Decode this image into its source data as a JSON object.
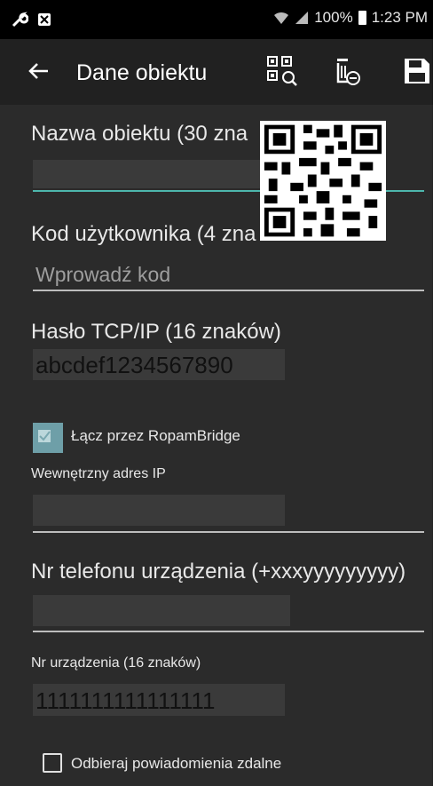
{
  "status_bar": {
    "battery": "100%",
    "time": "1:23 PM"
  },
  "app_bar": {
    "title": "Dane obiektu",
    "icons": [
      "back-arrow-icon",
      "qr-scan-icon",
      "delete-icon",
      "save-icon"
    ]
  },
  "form": {
    "object_name": {
      "label": "Nazwa obiektu (30 zna",
      "value": ""
    },
    "user_code": {
      "label": "Kod użytkownika (4 zna",
      "placeholder": "Wprowadź kod"
    },
    "tcp_password": {
      "label": "Hasło TCP/IP (16 znaków)",
      "value": "abcdef1234567890"
    },
    "ropambridge": {
      "label": "Łącz przez RopamBridge",
      "checked": true
    },
    "internal_ip": {
      "label": "Wewnętrzny adres IP",
      "value": ""
    },
    "phone": {
      "label": "Nr telefonu urządzenia (+xxxyyyyyyyyy)",
      "value": ""
    },
    "device_number": {
      "label": "Nr urządzenia (16 znaków)",
      "value": "1111111111111111"
    },
    "remote_notifications": {
      "label": "Odbieraj powiadomienia zdalne",
      "checked": false
    }
  },
  "colors": {
    "background": "#2b2b2b",
    "app_bar": "#212121",
    "accent": "#4db6ac"
  }
}
